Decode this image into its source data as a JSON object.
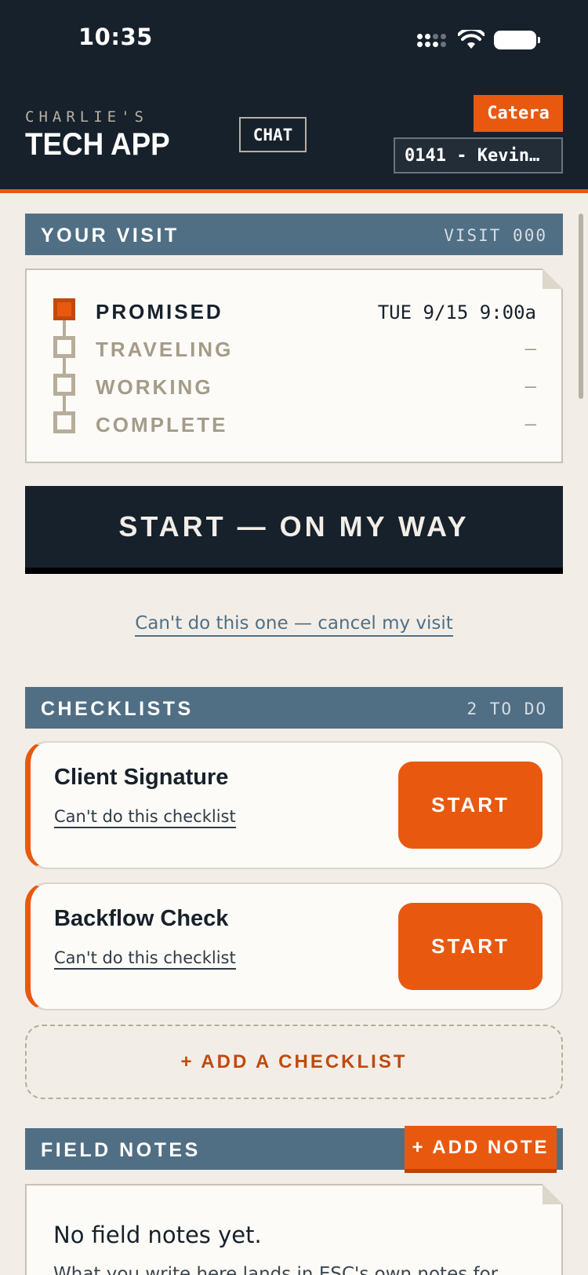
{
  "status_bar": {
    "time": "10:35"
  },
  "header": {
    "brand_sub": "CHARLIE'S",
    "brand_main": "TECH APP",
    "chat_label": "CHAT",
    "tenant_badge": "Catera",
    "tech_select_value": "0141 - Kevin…"
  },
  "visit": {
    "section_title": "YOUR VISIT",
    "section_meta": "VISIT 000",
    "stages": [
      {
        "label": "PROMISED",
        "value": "TUE 9/15 9:00a"
      },
      {
        "label": "TRAVELING",
        "value": "—"
      },
      {
        "label": "WORKING",
        "value": "—"
      },
      {
        "label": "COMPLETE",
        "value": "—"
      }
    ],
    "start_button": "START — ON MY WAY",
    "cancel_link": "Can't do this one — cancel my visit"
  },
  "checklists": {
    "section_title": "CHECKLISTS",
    "section_meta": "2 TO DO",
    "items": [
      {
        "title": "Client Signature",
        "skip_link": "Can't do this checklist",
        "start_label": "START"
      },
      {
        "title": "Backflow Check",
        "skip_link": "Can't do this checklist",
        "start_label": "START"
      }
    ],
    "add_label": "+ ADD A CHECKLIST"
  },
  "field_notes": {
    "section_title": "FIELD NOTES",
    "add_label": "+ ADD NOTE",
    "empty_text": "No field notes yet.",
    "hint_text": "What you write here lands in ESC's own notes for"
  },
  "colors": {
    "header_bg": "#17212b",
    "accent": "#e8590f",
    "section_bg": "#516f84",
    "page_bg": "#f2eee7"
  }
}
